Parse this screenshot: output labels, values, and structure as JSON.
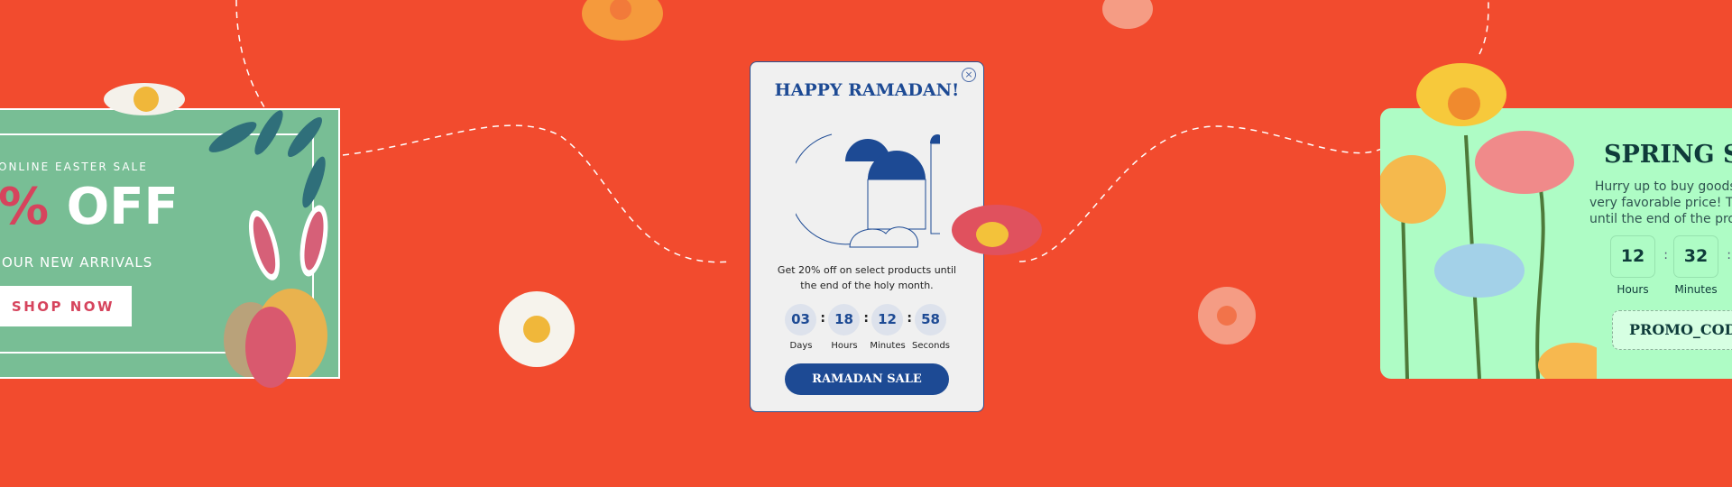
{
  "colors": {
    "background": "#F24B2E",
    "easter_green": "#78BE95",
    "ramadan_blue": "#1D4A94",
    "spring_mint": "#AEFCC5",
    "accent_pink": "#D6445D"
  },
  "easter": {
    "subtitle": "ONLINE EASTER SALE",
    "discount_pct": "%",
    "discount_off": " OFF",
    "line": "OUR NEW ARRIVALS",
    "button": "SHOP NOW"
  },
  "ramadan": {
    "title": "HAPPY RAMADAN!",
    "close_icon": "close-icon",
    "description": "Get 20% off on select products until the end of the holy month.",
    "countdown": [
      {
        "value": "03",
        "label": "Days"
      },
      {
        "value": "18",
        "label": "Hours"
      },
      {
        "value": "12",
        "label": "Minutes"
      },
      {
        "value": "58",
        "label": "Seconds"
      }
    ],
    "button": "RAMADAN SALE"
  },
  "spring": {
    "title": "SPRING SALE",
    "description_lines": [
      "Hurry up to buy goods at a",
      "very favorable price! The offer is valid",
      "until the end of the promotion"
    ],
    "countdown": [
      {
        "value": "12",
        "label": "Hours"
      },
      {
        "value": "32",
        "label": "Minutes"
      }
    ],
    "promo_code": "PROMO_CODE"
  }
}
